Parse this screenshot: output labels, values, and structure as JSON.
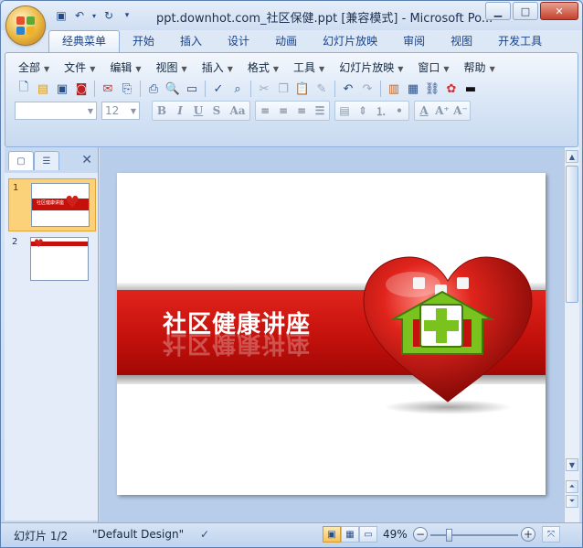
{
  "window": {
    "title": "ppt.downhot.com_社区保健.ppt [兼容模式] - Microsoft Po...",
    "minimize": "▁",
    "maximize": "□",
    "close": "✕"
  },
  "tabs": [
    {
      "label": "经典菜单",
      "active": true
    },
    {
      "label": "开始"
    },
    {
      "label": "插入"
    },
    {
      "label": "设计"
    },
    {
      "label": "动画"
    },
    {
      "label": "幻灯片放映"
    },
    {
      "label": "审阅"
    },
    {
      "label": "视图"
    },
    {
      "label": "开发工具"
    }
  ],
  "menus": [
    "全部",
    "文件",
    "编辑",
    "视图",
    "插入",
    "格式",
    "工具",
    "幻灯片放映",
    "窗口",
    "帮助"
  ],
  "format": {
    "font_name": "",
    "font_size": "12"
  },
  "pane": {
    "slides": [
      {
        "number": "1"
      },
      {
        "number": "2"
      }
    ],
    "thumb_title": "社区健康讲座"
  },
  "slide": {
    "title": "社区健康讲座"
  },
  "status": {
    "slide_counter": "幻灯片 1/2",
    "design": "\"Default Design\"",
    "zoom": "49%"
  },
  "colors": {
    "accent_red": "#c4110c",
    "heart_green": "#7ac21e"
  }
}
